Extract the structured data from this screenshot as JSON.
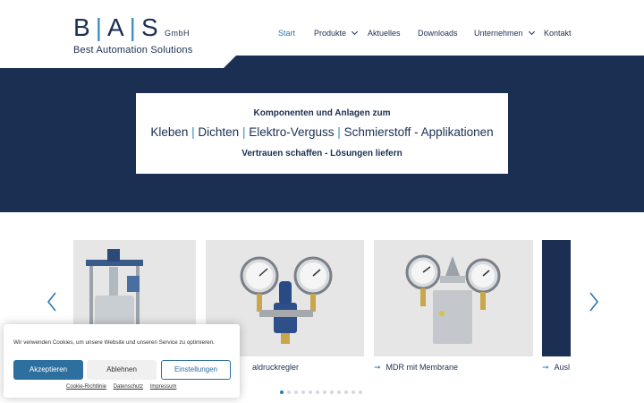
{
  "logo": {
    "letter_b": "B",
    "letter_a": "A",
    "letter_s": "S",
    "separator": "|",
    "suffix": "GmbH",
    "tagline": "Best Automation Solutions"
  },
  "nav": {
    "items": [
      {
        "label": "Start",
        "active": true
      },
      {
        "label": "Produkte",
        "dropdown": true
      },
      {
        "label": "Aktuelles"
      },
      {
        "label": "Downloads"
      },
      {
        "label": "Unternehmen",
        "dropdown": true
      },
      {
        "label": "Kontakt"
      }
    ]
  },
  "hero": {
    "top_line": "Komponenten und Anlagen zum",
    "main_parts": [
      "Kleben",
      "Dichten",
      "Elektro-Verguss",
      "Schmierstoff - Applikationen"
    ],
    "separator": "|",
    "bottom_line": "Vertrauen schaffen - Lösungen liefern"
  },
  "carousel": {
    "prev_icon": "chevron-left-icon",
    "next_icon": "chevron-right-icon",
    "cards": [
      {
        "label": ""
      },
      {
        "label": "aldruckregler"
      },
      {
        "label": "MDR mit Membrane"
      },
      {
        "label": "Ausl"
      }
    ],
    "arrow_glyph": "➞",
    "dot_count": 12,
    "active_dot": 0
  },
  "cookie": {
    "text": "Wir verwenden Cookies, um unsere Website und unseren Service zu optimieren.",
    "accept": "Akzeptieren",
    "reject": "Ablehnen",
    "settings": "Einstellungen",
    "links": [
      "Cookie-Richtlinie",
      "Datenschutz",
      "Impressum"
    ]
  },
  "colors": {
    "navy": "#1b2f52",
    "accent": "#2a78b5",
    "accept_button": "#2d6f9e"
  }
}
